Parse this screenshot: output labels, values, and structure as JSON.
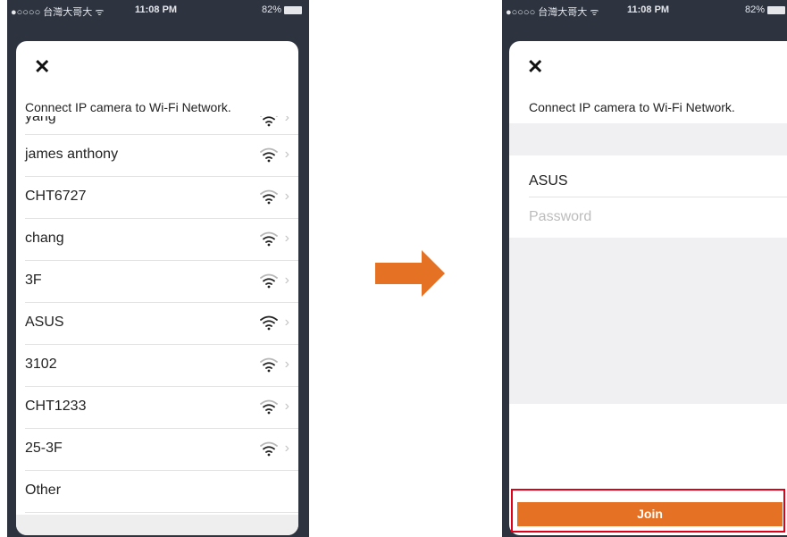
{
  "left_screen": {
    "status": {
      "carrier": "●○○○○ 台灣大哥大 ᯤ",
      "time": "11:08 PM",
      "battery": "82%"
    },
    "close_icon": "close-icon",
    "subtitle": "Connect IP camera to Wi-Fi Network.",
    "networks": [
      {
        "name": "yang",
        "signal": 2
      },
      {
        "name": "james anthony",
        "signal": 2
      },
      {
        "name": "CHT6727",
        "signal": 2
      },
      {
        "name": "chang",
        "signal": 2
      },
      {
        "name": "3F",
        "signal": 2
      },
      {
        "name": "ASUS",
        "signal": 3
      },
      {
        "name": "3102",
        "signal": 2
      },
      {
        "name": "CHT1233",
        "signal": 2
      },
      {
        "name": "25-3F",
        "signal": 2
      }
    ],
    "other_label": "Other"
  },
  "right_screen": {
    "status": {
      "carrier": "●○○○○ 台灣大哥大 ᯤ",
      "time": "11:08 PM",
      "battery": "82%"
    },
    "close_icon": "close-icon",
    "subtitle": "Connect IP camera to Wi-Fi Network.",
    "ssid_value": "ASUS",
    "password_placeholder": "Password",
    "join_label": "Join"
  },
  "arrow_icon": "arrow-right-icon",
  "colors": {
    "accent": "#e57224",
    "highlight": "#e0001a",
    "phone_bg": "#2d3440"
  }
}
